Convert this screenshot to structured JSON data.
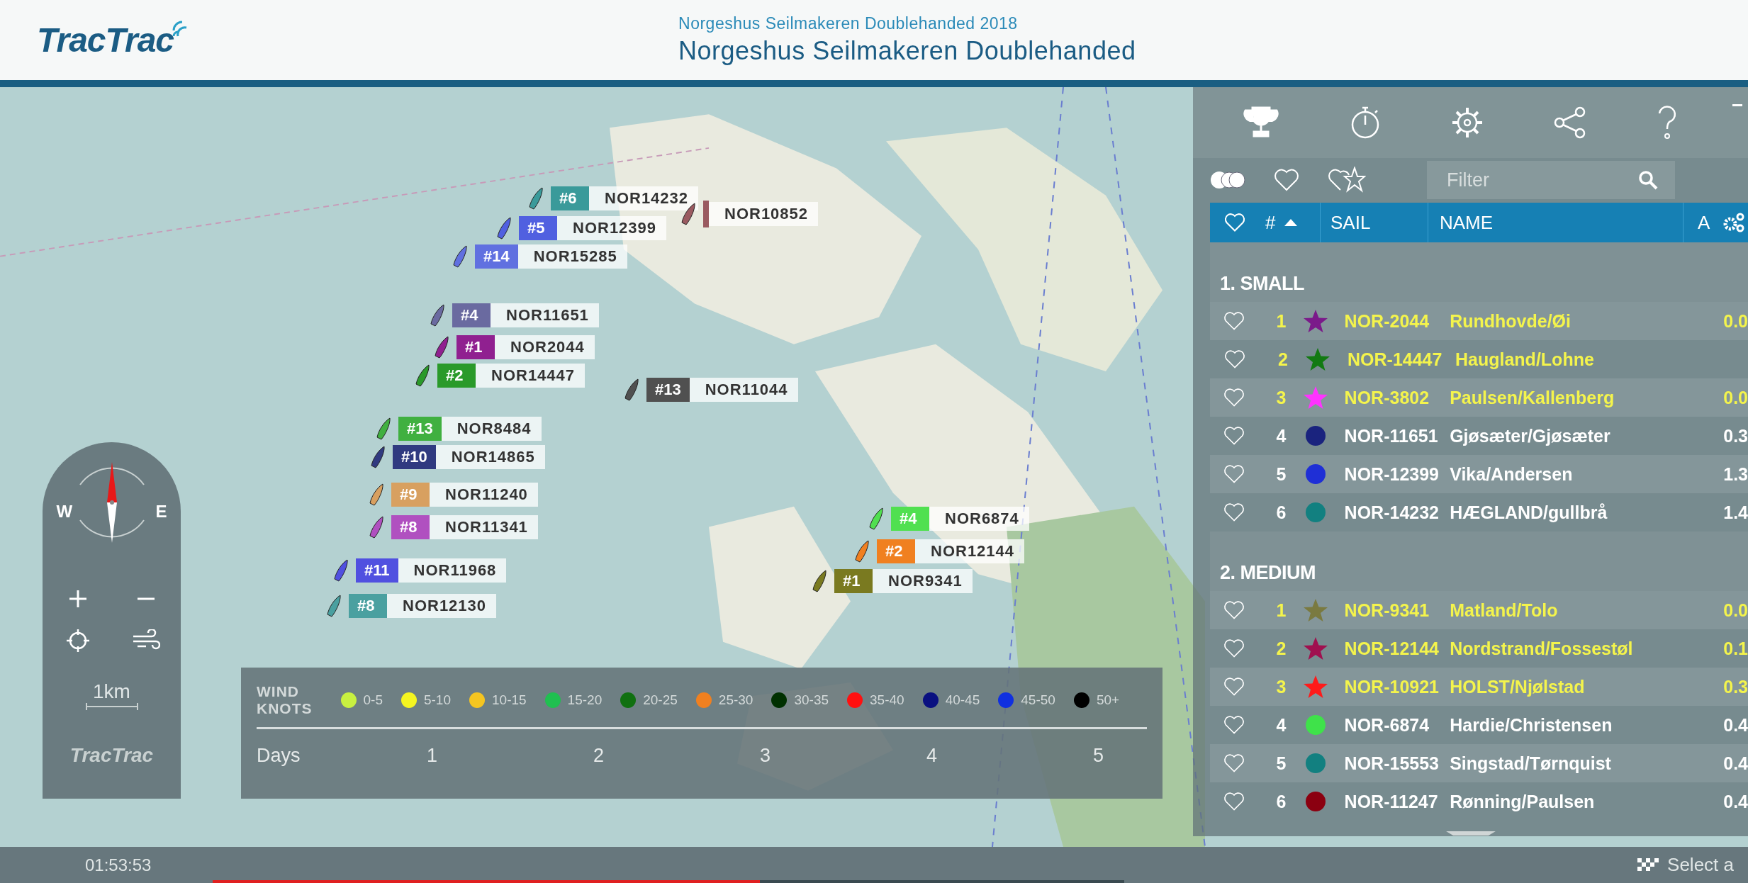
{
  "header": {
    "logo": "TracTrac",
    "subtitle": "Norgeshus Seilmakeren Doublehanded 2018",
    "title": "Norgeshus Seilmakeren Doublehanded"
  },
  "map": {
    "boats": [
      {
        "rank": "#6",
        "sail": "NOR14232",
        "color": "#3a9a9a"
      },
      {
        "sail": "NOR10852",
        "color": "#9a5a60"
      },
      {
        "rank": "#5",
        "sail": "NOR12399",
        "color": "#5060e0"
      },
      {
        "rank": "#14",
        "sail": "NOR15285",
        "color": "#6070e0"
      },
      {
        "rank": "#4",
        "sail": "NOR11651",
        "color": "#6a6aa0"
      },
      {
        "rank": "#1",
        "sail": "NOR2044",
        "color": "#902090"
      },
      {
        "rank": "#2",
        "sail": "NOR14447",
        "color": "#2a9a2a"
      },
      {
        "rank": "#13",
        "sail": "NOR8484",
        "color": "#40b040"
      },
      {
        "rank": "#10",
        "sail": "NOR14865",
        "color": "#303a80"
      },
      {
        "rank": "#9",
        "sail": "NOR11240",
        "color": "#d8a060"
      },
      {
        "rank": "#8",
        "sail": "NOR11341",
        "color": "#b050c0"
      },
      {
        "rank": "#11",
        "sail": "NOR11968",
        "color": "#5050e0"
      },
      {
        "rank": "#8",
        "sail": "NOR12130",
        "color": "#4aa0a0"
      },
      {
        "rank": "#13",
        "sail": "NOR11044",
        "color": "#505050"
      },
      {
        "rank": "#4",
        "sail": "NOR6874",
        "color": "#50e050"
      },
      {
        "rank": "#2",
        "sail": "NOR12144",
        "color": "#f08020"
      },
      {
        "rank": "#1",
        "sail": "NOR9341",
        "color": "#7a7a20"
      }
    ]
  },
  "map_controls": {
    "compass": {
      "west": "W",
      "east": "E"
    },
    "scale": "1km",
    "logo": "TracTrac"
  },
  "wind_legend": {
    "title_lines": [
      "WIND",
      "KNOTS"
    ],
    "items": [
      {
        "label": "0-5",
        "color": "#c8f040"
      },
      {
        "label": "5-10",
        "color": "#f5f520"
      },
      {
        "label": "10-15",
        "color": "#f5c520"
      },
      {
        "label": "15-20",
        "color": "#20c050"
      },
      {
        "label": "20-25",
        "color": "#107010"
      },
      {
        "label": "25-30",
        "color": "#f08020"
      },
      {
        "label": "30-35",
        "color": "#003000"
      },
      {
        "label": "35-40",
        "color": "#ff1010"
      },
      {
        "label": "40-45",
        "color": "#0a1080"
      },
      {
        "label": "45-50",
        "color": "#1030e0"
      },
      {
        "label": "50+",
        "color": "#000000"
      }
    ],
    "timeline": {
      "label": "Days",
      "ticks": [
        "1",
        "2",
        "3",
        "4",
        "5"
      ]
    }
  },
  "panel": {
    "filter": {
      "placeholder": "Filter"
    },
    "columns": [
      "#",
      "SAIL",
      "NAME",
      "A"
    ],
    "groups": [
      {
        "title": "1. SMALL",
        "rows": [
          {
            "favorite": false,
            "rank": "1",
            "kind": "star",
            "color": "#7b1a8a",
            "sail": "NOR-2044",
            "name": "Rundhovde/Øi",
            "value": "0.0",
            "highlighted": true
          },
          {
            "favorite": false,
            "rank": "2",
            "kind": "star",
            "color": "#127a12",
            "sail": "NOR-14447",
            "name": "Haugland/Lohne",
            "highlighted": true
          },
          {
            "favorite": false,
            "rank": "3",
            "kind": "star",
            "color": "#ff33ff",
            "sail": "NOR-3802",
            "name": "Paulsen/Kallenberg",
            "value": "0.0",
            "highlighted": true
          },
          {
            "favorite": false,
            "rank": "4",
            "kind": "circle",
            "color": "#1a237e",
            "sail": "NOR-11651",
            "name": "Gjøsæter/Gjøsæter",
            "value": "0.3",
            "highlighted": false
          },
          {
            "favorite": false,
            "rank": "5",
            "kind": "circle",
            "color": "#1f2fd6",
            "sail": "NOR-12399",
            "name": "Vika/Andersen",
            "value": "1.3",
            "highlighted": false
          },
          {
            "favorite": false,
            "rank": "6",
            "kind": "circle",
            "color": "#128080",
            "sail": "NOR-14232",
            "name": "HÆGLAND/gullbrå",
            "value": "1.4",
            "highlighted": false
          }
        ]
      },
      {
        "title": "2. MEDIUM",
        "rows": [
          {
            "favorite": false,
            "rank": "1",
            "kind": "star",
            "color": "#7a7a40",
            "sail": "NOR-9341",
            "name": "Matland/Tolo",
            "value": "0.0",
            "highlighted": true
          },
          {
            "favorite": false,
            "rank": "2",
            "kind": "star",
            "color": "#a0104f",
            "sail": "NOR-12144",
            "name": "Nordstrand/Fossestøl",
            "value": "0.1",
            "highlighted": true
          },
          {
            "favorite": false,
            "rank": "3",
            "kind": "star",
            "color": "#ff1a1a",
            "sail": "NOR-10921",
            "name": "HOLST/Njølstad",
            "value": "0.3",
            "highlighted": true
          },
          {
            "favorite": false,
            "rank": "4",
            "kind": "circle",
            "color": "#3fe24a",
            "sail": "NOR-6874",
            "name": "Hardie/Christensen",
            "value": "0.4",
            "highlighted": false
          },
          {
            "favorite": false,
            "rank": "5",
            "kind": "circle",
            "color": "#128080",
            "sail": "NOR-15553",
            "name": "Singstad/Tørnquist",
            "value": "0.4",
            "highlighted": false
          },
          {
            "favorite": false,
            "rank": "6",
            "kind": "circle",
            "color": "#8b0010",
            "sail": "NOR-11247",
            "name": "Rønning/Paulsen",
            "value": "0.4",
            "highlighted": false
          }
        ]
      }
    ]
  },
  "status_bar": {
    "time": "01:53:53",
    "select": "Select a"
  }
}
